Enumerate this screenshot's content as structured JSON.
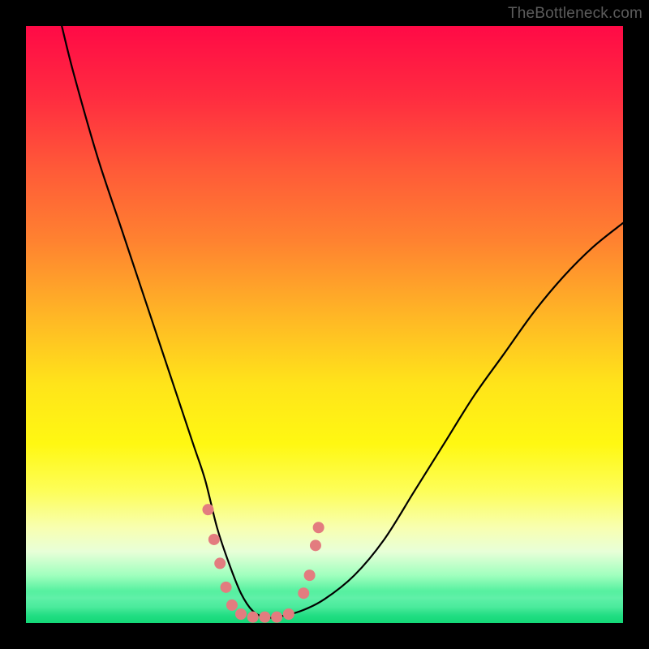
{
  "watermark": "TheBottleneck.com",
  "chart_data": {
    "type": "line",
    "title": "",
    "xlabel": "",
    "ylabel": "",
    "xlim": [
      0,
      100
    ],
    "ylim": [
      0,
      100
    ],
    "grid": false,
    "series": [
      {
        "name": "curve",
        "x": [
          6,
          8,
          12,
          16,
          20,
          24,
          28,
          30,
          32,
          34,
          36,
          38,
          40,
          42,
          46,
          50,
          55,
          60,
          65,
          70,
          75,
          80,
          85,
          90,
          95,
          100
        ],
        "y": [
          100,
          92,
          78,
          66,
          54,
          42,
          30,
          24,
          16,
          10,
          5,
          2,
          1,
          1,
          2,
          4,
          8,
          14,
          22,
          30,
          38,
          45,
          52,
          58,
          63,
          67
        ]
      }
    ],
    "markers": {
      "color": "#e37c7f",
      "radius_px": 7,
      "points": [
        {
          "x": 30.5,
          "y": 19
        },
        {
          "x": 31.5,
          "y": 14
        },
        {
          "x": 32.5,
          "y": 10
        },
        {
          "x": 33.5,
          "y": 6
        },
        {
          "x": 34.5,
          "y": 3
        },
        {
          "x": 36,
          "y": 1.5
        },
        {
          "x": 38,
          "y": 1
        },
        {
          "x": 40,
          "y": 1
        },
        {
          "x": 42,
          "y": 1
        },
        {
          "x": 44,
          "y": 1.5
        },
        {
          "x": 46.5,
          "y": 5
        },
        {
          "x": 47.5,
          "y": 8
        },
        {
          "x": 48.5,
          "y": 13
        },
        {
          "x": 49,
          "y": 16
        }
      ]
    }
  }
}
